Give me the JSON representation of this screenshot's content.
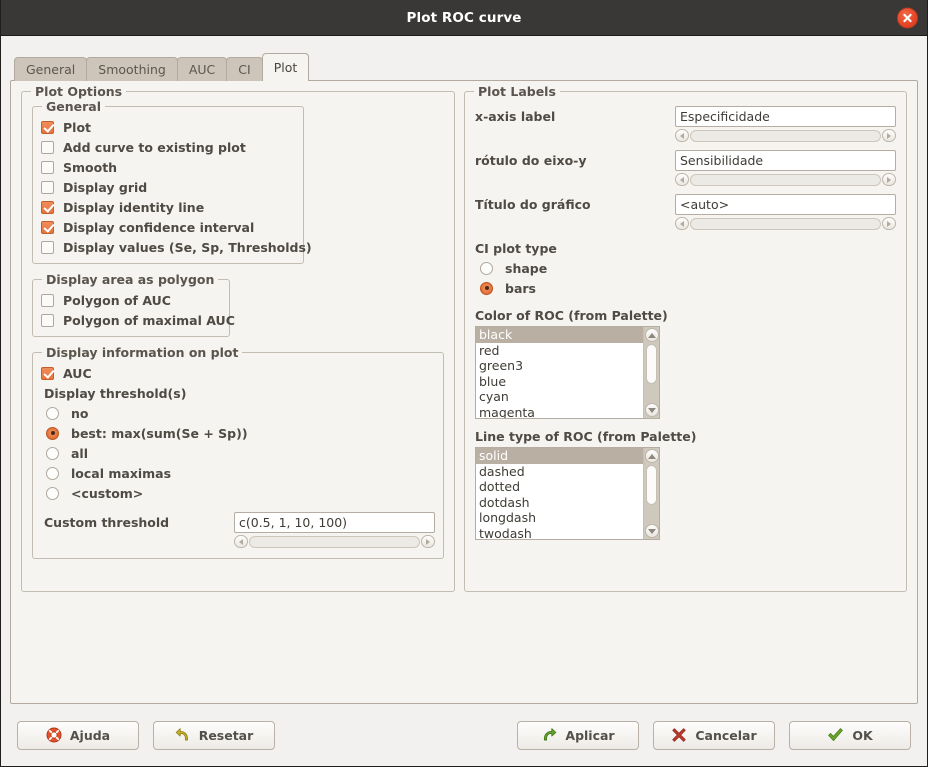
{
  "window": {
    "title": "Plot ROC curve",
    "close_icon": "close-icon"
  },
  "tabs": [
    {
      "label": "General",
      "active": false
    },
    {
      "label": "Smoothing",
      "active": false
    },
    {
      "label": "AUC",
      "active": false
    },
    {
      "label": "CI",
      "active": false
    },
    {
      "label": "Plot",
      "active": true
    }
  ],
  "plot_options": {
    "legend": "Plot Options",
    "general": {
      "legend": "General",
      "checkboxes": [
        {
          "label": "Plot",
          "checked": true
        },
        {
          "label": "Add curve to existing plot",
          "checked": false
        },
        {
          "label": "Smooth",
          "checked": false
        },
        {
          "label": "Display grid",
          "checked": false
        },
        {
          "label": "Display identity line",
          "checked": true
        },
        {
          "label": "Display confidence interval",
          "checked": true
        },
        {
          "label": "Display values (Se, Sp, Thresholds)",
          "checked": false
        }
      ]
    },
    "polygon": {
      "legend": "Display area as polygon",
      "checkboxes": [
        {
          "label": "Polygon of AUC",
          "checked": false
        },
        {
          "label": "Polygon of maximal AUC",
          "checked": false
        }
      ]
    },
    "info": {
      "legend": "Display information on plot",
      "auc": {
        "label": "AUC",
        "checked": true
      },
      "threshold_label": "Display threshold(s)",
      "threshold_options": [
        {
          "label": "no",
          "selected": false
        },
        {
          "label": "best: max(sum(Se + Sp))",
          "selected": true
        },
        {
          "label": "all",
          "selected": false
        },
        {
          "label": "local maximas",
          "selected": false
        },
        {
          "label": "<custom>",
          "selected": false
        }
      ],
      "custom_threshold": {
        "label": "Custom threshold",
        "value": "c(0.5, 1, 10, 100)",
        "placeholder": ""
      }
    }
  },
  "plot_labels": {
    "legend": "Plot Labels",
    "fields": [
      {
        "caption": "x-axis label",
        "value": "Especificidade",
        "placeholder": ""
      },
      {
        "caption": "rótulo do eixo-y",
        "value": "Sensibilidade",
        "placeholder": ""
      },
      {
        "caption": "Título do gráfico",
        "value": "<auto>",
        "placeholder": ""
      }
    ],
    "ci_plot_type": {
      "label": "CI plot type",
      "options": [
        {
          "label": "shape",
          "selected": false
        },
        {
          "label": "bars",
          "selected": true
        }
      ]
    },
    "color_list": {
      "caption": "Color of ROC (from Palette)",
      "items": [
        "black",
        "red",
        "green3",
        "blue",
        "cyan",
        "magenta"
      ],
      "selected": "black"
    },
    "linetype_list": {
      "caption": "Line type of ROC (from Palette)",
      "items": [
        "solid",
        "dashed",
        "dotted",
        "dotdash",
        "longdash",
        "twodash"
      ],
      "selected": "solid"
    }
  },
  "buttons": {
    "help": {
      "label": "Ajuda",
      "icon": "lifebuoy-icon"
    },
    "reset": {
      "label": "Resetar",
      "icon": "undo-arrow-icon"
    },
    "apply": {
      "label": "Aplicar",
      "icon": "forward-arrow-icon"
    },
    "cancel": {
      "label": "Cancelar",
      "icon": "red-x-icon"
    },
    "ok": {
      "label": "OK",
      "icon": "green-check-icon"
    }
  },
  "colors": {
    "accent": "#e8743b",
    "titlebar": "#3a3836",
    "close": "#e8472a",
    "selection": "#b9b0a3",
    "panel": "#f5f4f1"
  }
}
